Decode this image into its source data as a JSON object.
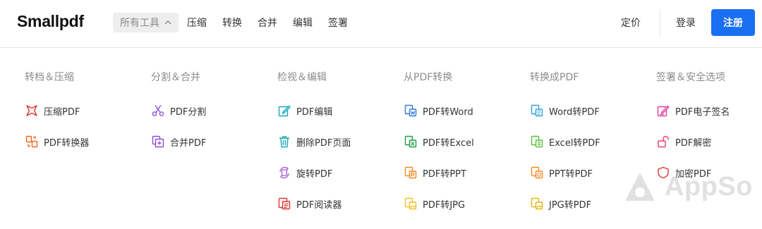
{
  "header": {
    "logo": "Smallpdf",
    "tools_menu_label": "所有工具",
    "nav": [
      "压缩",
      "转换",
      "合并",
      "编辑",
      "签署"
    ],
    "pricing": "定价",
    "login": "登录",
    "signup": "注册"
  },
  "menu": {
    "columns": [
      {
        "title": "转档＆压缩",
        "items": [
          {
            "label": "压缩PDF",
            "icon": "compress-icon",
            "color": "#e0342b"
          },
          {
            "label": "PDF转换器",
            "icon": "converter-icon",
            "color": "#f2641f"
          }
        ]
      },
      {
        "title": "分割＆合并",
        "items": [
          {
            "label": "PDF分割",
            "icon": "scissors-icon",
            "color": "#8f4fd9"
          },
          {
            "label": "合并PDF",
            "icon": "merge-icon",
            "color": "#8f4fd9"
          }
        ]
      },
      {
        "title": "检视＆编辑",
        "items": [
          {
            "label": "PDF编辑",
            "icon": "edit-icon",
            "color": "#13a8b8"
          },
          {
            "label": "删除PDF页面",
            "icon": "trash-icon",
            "color": "#13a8b8"
          },
          {
            "label": "旋转PDF",
            "icon": "rotate-icon",
            "color": "#a45bd6"
          },
          {
            "label": "PDF阅读器",
            "icon": "reader-icon",
            "color": "#e0342b"
          }
        ]
      },
      {
        "title": "从PDF转换",
        "items": [
          {
            "label": "PDF转Word",
            "icon": "word-icon",
            "color": "#2f7bd9"
          },
          {
            "label": "PDF转Excel",
            "icon": "excel-icon",
            "color": "#1f9a45"
          },
          {
            "label": "PDF转PPT",
            "icon": "ppt-icon",
            "color": "#f28a1f"
          },
          {
            "label": "PDF转JPG",
            "icon": "jpg-icon",
            "color": "#f2c21f"
          }
        ]
      },
      {
        "title": "转换成PDF",
        "items": [
          {
            "label": "Word转PDF",
            "icon": "word-icon",
            "color": "#2fa4d9"
          },
          {
            "label": "Excel转PDF",
            "icon": "excel-icon",
            "color": "#5cbf3a"
          },
          {
            "label": "PPT转PDF",
            "icon": "ppt-icon",
            "color": "#f28a1f"
          },
          {
            "label": "JPG转PDF",
            "icon": "jpg-icon",
            "color": "#e6b413"
          }
        ]
      },
      {
        "title": "签署＆安全选项",
        "items": [
          {
            "label": "PDF电子签名",
            "icon": "sign-icon",
            "color": "#e0409a"
          },
          {
            "label": "PDF解密",
            "icon": "unlock-icon",
            "color": "#ee3f6a"
          },
          {
            "label": "加密PDF",
            "icon": "shield-icon",
            "color": "#e0342b"
          }
        ]
      }
    ]
  },
  "watermark": "AppSo",
  "colors": {
    "accent": "#1a6ff2"
  }
}
